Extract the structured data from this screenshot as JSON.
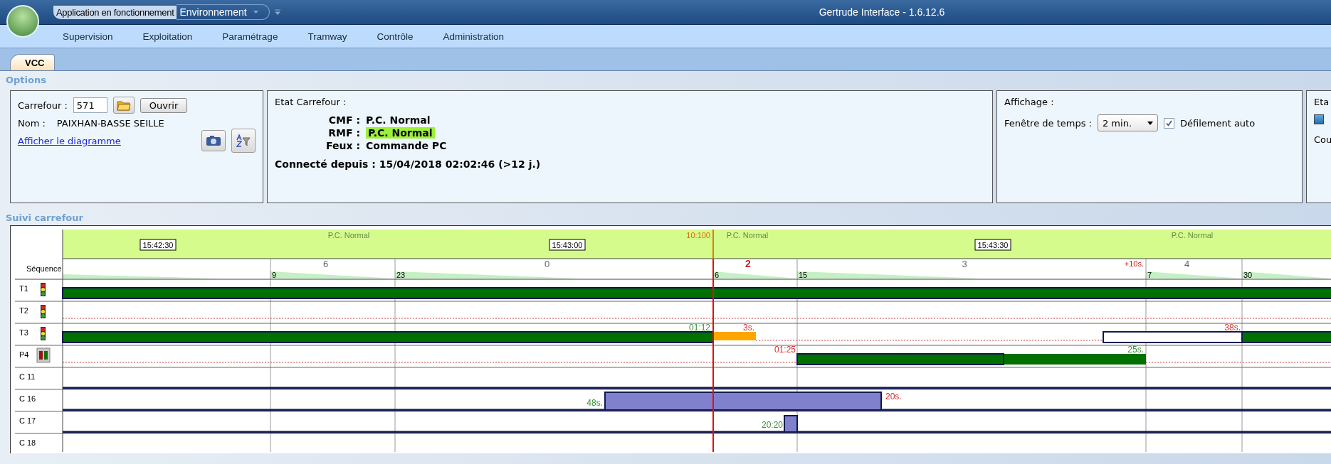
{
  "window": {
    "status": "Application en fonctionnement",
    "environment": "Environnement",
    "title": "Gertrude Interface - 1.6.12.6"
  },
  "menu": [
    "Supervision",
    "Exploitation",
    "Paramétrage",
    "Tramway",
    "Contrôle",
    "Administration"
  ],
  "tabs": [
    {
      "label": "VCC",
      "selected": true
    }
  ],
  "options": {
    "title": "Options",
    "carrefour": {
      "label": "Carrefour :",
      "value": "571",
      "open_button": "Ouvrir",
      "name_label": "Nom :",
      "name": "PAIXHAN-BASSE SEILLE",
      "diagram_link": "Afficher le diagramme"
    },
    "etat": {
      "title": "Etat Carrefour :",
      "rows": [
        {
          "label": "CMF :",
          "value": "P.C. Normal",
          "highlighted": false
        },
        {
          "label": "RMF :",
          "value": "P.C. Normal",
          "highlighted": true
        },
        {
          "label": "Feux :",
          "value": "Commande PC",
          "highlighted": false
        }
      ],
      "connected": "Connecté depuis : 15/04/2018 02:02:46 (>12 j.)"
    },
    "affichage": {
      "title": "Affichage :",
      "window_label": "Fenêtre de temps :",
      "window_value": "2 min.",
      "auto_scroll": {
        "label": "Défilement auto",
        "checked": true
      }
    },
    "etat_cut": {
      "title": "Eta",
      "checked": true,
      "label": "Cou"
    }
  },
  "suivi": {
    "title": "Suivi carrefour",
    "modes": [
      "P.C. Normal",
      "P.C. Normal",
      "P.C. Normal"
    ],
    "time_labels": [
      "15:42:30",
      "15:43:00",
      "15:43:30"
    ],
    "cursor_label": "10:100",
    "sequence_label": "Séquence",
    "sequence": [
      {
        "start": "9",
        "phase": "6",
        "current": false
      },
      {
        "start": "23",
        "phase": "0",
        "current": false
      },
      {
        "start": "6",
        "phase": "2",
        "current": true
      },
      {
        "start": "15",
        "phase": "3",
        "current": false,
        "note": "+10s."
      },
      {
        "start": "7",
        "phase": "4",
        "current": false
      },
      {
        "start": "30"
      }
    ],
    "rows": [
      {
        "label": "T1",
        "kind": "vehicle"
      },
      {
        "label": "T2",
        "kind": "vehicle"
      },
      {
        "label": "T3",
        "kind": "vehicle",
        "marks": [
          {
            "text": "01:12",
            "color": "#3c8c3c"
          },
          {
            "text": "3s.",
            "color": "#d03030"
          },
          {
            "text": "38s.",
            "color": "#d03030"
          }
        ]
      },
      {
        "label": "P4",
        "kind": "pedestrian",
        "marks": [
          {
            "text": "01:25",
            "color": "#d03030"
          },
          {
            "text": "25s.",
            "color": "#3c8c3c"
          }
        ]
      },
      {
        "label": "C 11",
        "kind": "detector"
      },
      {
        "label": "C 16",
        "kind": "detector",
        "marks": [
          {
            "text": "48s.",
            "color": "#3c8c3c"
          },
          {
            "text": "20s.",
            "color": "#d02828"
          }
        ]
      },
      {
        "label": "C 17",
        "kind": "detector",
        "marks": [
          {
            "text": "20:20",
            "color": "#3c8c3c"
          }
        ]
      },
      {
        "label": "C 18",
        "kind": "detector"
      }
    ]
  }
}
